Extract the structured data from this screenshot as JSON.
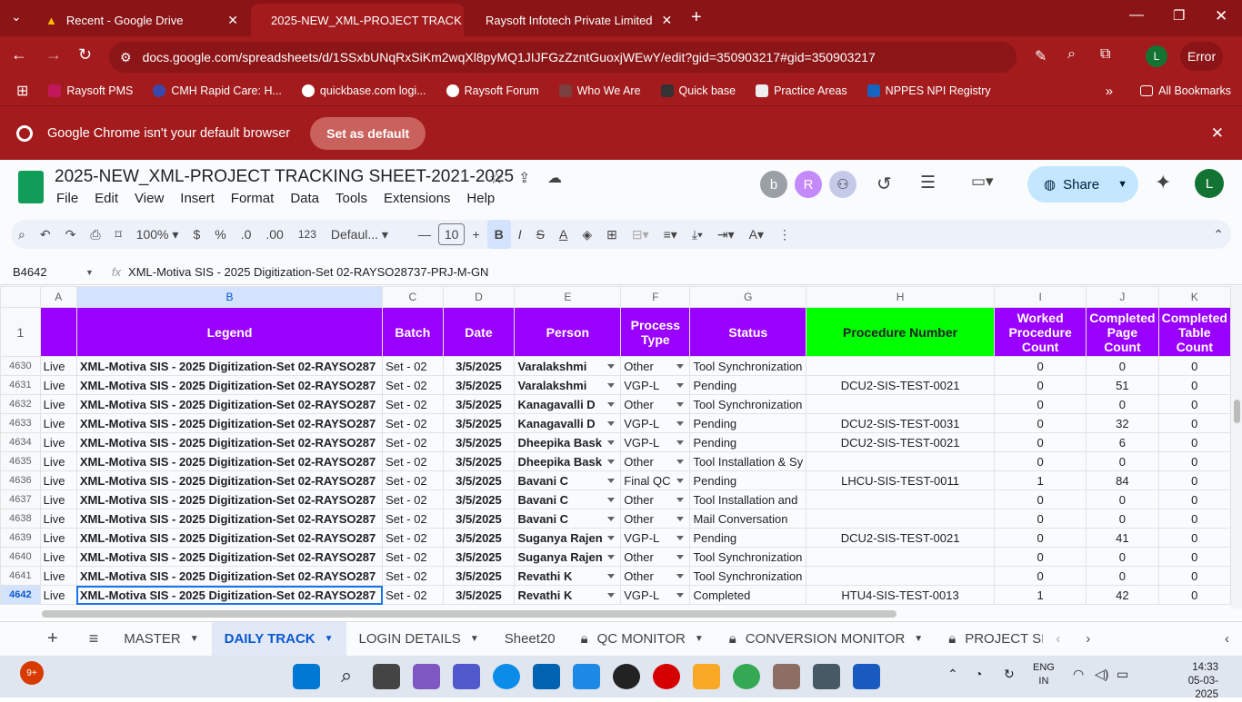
{
  "tabs": [
    {
      "label": "Recent - Google Drive"
    },
    {
      "label": "2025-NEW_XML-PROJECT TRACK"
    },
    {
      "label": "Raysoft Infotech Private Limited"
    }
  ],
  "url": "docs.google.com/spreadsheets/d/1SSxbUNqRxSiKm2wqXl8pyMQ1JIJFGzZzntGuoxjWEwY/edit?gid=350903217#gid=350903217",
  "profile": {
    "initial": "L",
    "status": "Error"
  },
  "bookmarks": [
    "Raysoft PMS",
    "CMH Rapid Care: H...",
    "quickbase.com logi...",
    "Raysoft Forum",
    "Who We Are",
    "Quick base",
    "Practice Areas",
    "NPPES NPI Registry",
    "All Bookmarks"
  ],
  "banner": {
    "text": "Google Chrome isn't your default browser",
    "button": "Set as default"
  },
  "doc": {
    "title": "2025-NEW_XML-PROJECT TRACKING SHEET-2021-2025",
    "menu": [
      "File",
      "Edit",
      "View",
      "Insert",
      "Format",
      "Data",
      "Tools",
      "Extensions",
      "Help"
    ],
    "share": "Share",
    "avatars": [
      "b",
      "R"
    ],
    "user": "L"
  },
  "toolbar": {
    "zoom": "100%",
    "currency": "$",
    "percent": "%",
    "dec_less": ".0",
    "dec_more": ".00",
    "format": "123",
    "font": "Defaul...",
    "size": "10"
  },
  "formula": {
    "cell": "B4642",
    "fx": "fx",
    "value": "XML-Motiva SIS - 2025 Digitization-Set 02-RAYSO28737-PRJ-M-GN"
  },
  "columns": [
    "A",
    "B",
    "C",
    "D",
    "E",
    "F",
    "G",
    "H",
    "I",
    "J",
    "K"
  ],
  "header_row": {
    "num": "1",
    "cells": [
      "",
      "Legend",
      "Batch",
      "Date",
      "Person",
      "Process Type",
      "Status",
      "Procedure Number",
      "Worked Procedure Count",
      "Completed Page Count",
      "Completed Table Count"
    ]
  },
  "rows": [
    {
      "n": "4630",
      "a": "Live",
      "b": "XML-Motiva SIS - 2025 Digitization-Set 02-RAYSO287",
      "c": "Set - 02",
      "d": "3/5/2025",
      "e": "Varalakshmi",
      "f": "Other",
      "g": "Tool Synchronization",
      "h": "",
      "i": "0",
      "j": "0",
      "k": "0"
    },
    {
      "n": "4631",
      "a": "Live",
      "b": "XML-Motiva SIS - 2025 Digitization-Set 02-RAYSO287",
      "c": "Set - 02",
      "d": "3/5/2025",
      "e": "Varalakshmi",
      "f": "VGP-L",
      "g": "Pending",
      "h": "DCU2-SIS-TEST-0021",
      "i": "0",
      "j": "51",
      "k": "0"
    },
    {
      "n": "4632",
      "a": "Live",
      "b": "XML-Motiva SIS - 2025 Digitization-Set 02-RAYSO287",
      "c": "Set - 02",
      "d": "3/5/2025",
      "e": "Kanagavalli D",
      "f": "Other",
      "g": "Tool Synchronization",
      "h": "",
      "i": "0",
      "j": "0",
      "k": "0"
    },
    {
      "n": "4633",
      "a": "Live",
      "b": "XML-Motiva SIS - 2025 Digitization-Set 02-RAYSO287",
      "c": "Set - 02",
      "d": "3/5/2025",
      "e": "Kanagavalli D",
      "f": "VGP-L",
      "g": "Pending",
      "h": "DCU2-SIS-TEST-0031",
      "i": "0",
      "j": "32",
      "k": "0"
    },
    {
      "n": "4634",
      "a": "Live",
      "b": "XML-Motiva SIS - 2025 Digitization-Set 02-RAYSO287",
      "c": "Set - 02",
      "d": "3/5/2025",
      "e": "Dheepika Bask",
      "f": "VGP-L",
      "g": "Pending",
      "h": "DCU2-SIS-TEST-0021",
      "i": "0",
      "j": "6",
      "k": "0"
    },
    {
      "n": "4635",
      "a": "Live",
      "b": "XML-Motiva SIS - 2025 Digitization-Set 02-RAYSO287",
      "c": "Set - 02",
      "d": "3/5/2025",
      "e": "Dheepika Bask",
      "f": "Other",
      "g": "Tool Installation & Sy",
      "h": "",
      "i": "0",
      "j": "0",
      "k": "0"
    },
    {
      "n": "4636",
      "a": "Live",
      "b": "XML-Motiva SIS - 2025 Digitization-Set 02-RAYSO287",
      "c": "Set - 02",
      "d": "3/5/2025",
      "e": "Bavani C",
      "f": "Final QC",
      "g": "Pending",
      "h": "LHCU-SIS-TEST-0011",
      "i": "1",
      "j": "84",
      "k": "0"
    },
    {
      "n": "4637",
      "a": "Live",
      "b": "XML-Motiva SIS - 2025 Digitization-Set 02-RAYSO287",
      "c": "Set - 02",
      "d": "3/5/2025",
      "e": "Bavani C",
      "f": "Other",
      "g": "Tool Installation and",
      "h": "",
      "i": "0",
      "j": "0",
      "k": "0"
    },
    {
      "n": "4638",
      "a": "Live",
      "b": "XML-Motiva SIS - 2025 Digitization-Set 02-RAYSO287",
      "c": "Set - 02",
      "d": "3/5/2025",
      "e": "Bavani C",
      "f": "Other",
      "g": "Mail Conversation",
      "h": "",
      "i": "0",
      "j": "0",
      "k": "0"
    },
    {
      "n": "4639",
      "a": "Live",
      "b": "XML-Motiva SIS - 2025 Digitization-Set 02-RAYSO287",
      "c": "Set - 02",
      "d": "3/5/2025",
      "e": "Suganya Rajen",
      "f": "VGP-L",
      "g": "Pending",
      "h": "DCU2-SIS-TEST-0021",
      "i": "0",
      "j": "41",
      "k": "0"
    },
    {
      "n": "4640",
      "a": "Live",
      "b": "XML-Motiva SIS - 2025 Digitization-Set 02-RAYSO287",
      "c": "Set - 02",
      "d": "3/5/2025",
      "e": "Suganya Rajen",
      "f": "Other",
      "g": "Tool Synchronization",
      "h": "",
      "i": "0",
      "j": "0",
      "k": "0"
    },
    {
      "n": "4641",
      "a": "Live",
      "b": "XML-Motiva SIS - 2025 Digitization-Set 02-RAYSO287",
      "c": "Set - 02",
      "d": "3/5/2025",
      "e": "Revathi K",
      "f": "Other",
      "g": "Tool Synchronization",
      "h": "",
      "i": "0",
      "j": "0",
      "k": "0"
    },
    {
      "n": "4642",
      "a": "Live",
      "b": "XML-Motiva SIS - 2025 Digitization-Set 02-RAYSO287",
      "c": "Set - 02",
      "d": "3/5/2025",
      "e": "Revathi K",
      "f": "VGP-L",
      "g": "Completed",
      "h": "HTU4-SIS-TEST-0013",
      "i": "1",
      "j": "42",
      "k": "0"
    }
  ],
  "sheets": [
    {
      "label": "MASTER"
    },
    {
      "label": "DAILY TRACK"
    },
    {
      "label": "LOGIN DETAILS"
    },
    {
      "label": "Sheet20"
    },
    {
      "label": "QC MONITOR"
    },
    {
      "label": "CONVERSION MONITOR"
    },
    {
      "label": "PROJECT SI"
    }
  ],
  "taskbar": {
    "lang": "ENG",
    "region": "IN",
    "time": "14:33",
    "date": "05-03-2025",
    "badge": "9+"
  }
}
